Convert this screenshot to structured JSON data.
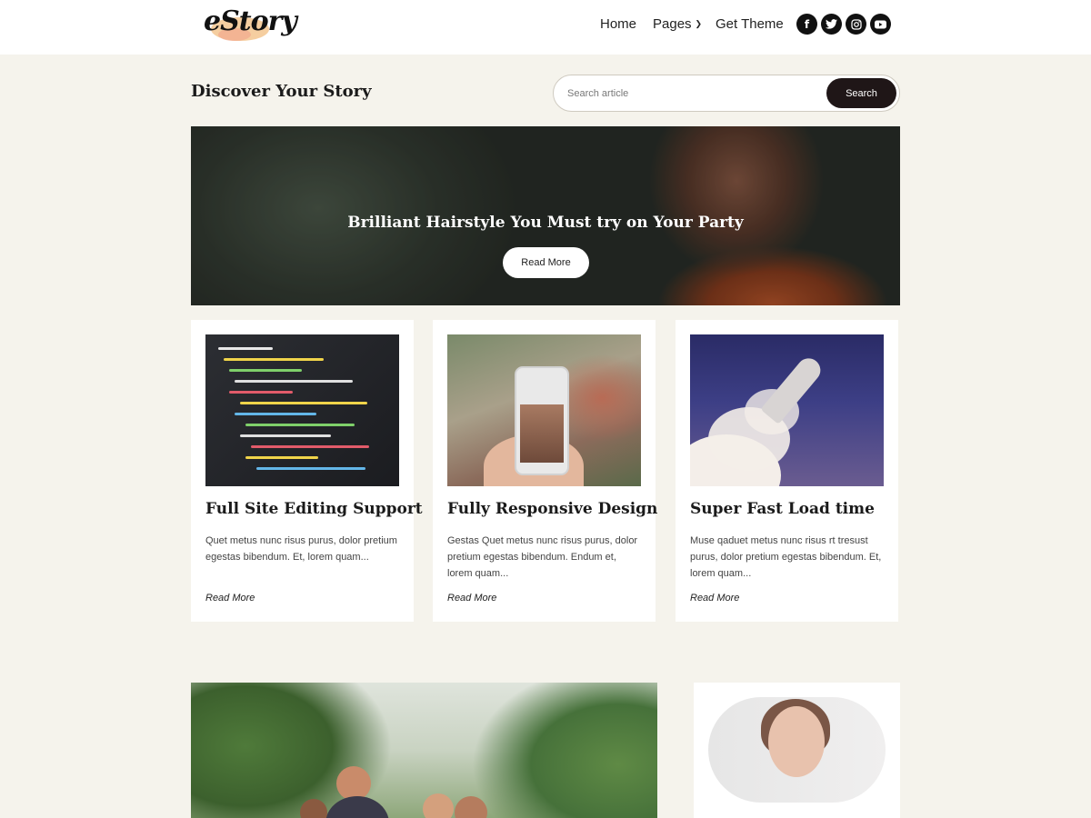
{
  "header": {
    "logo_text": "eStory",
    "nav": [
      {
        "label": "Home"
      },
      {
        "label": "Pages"
      },
      {
        "label": "Get Theme"
      }
    ],
    "social_icons": [
      "facebook-icon",
      "twitter-icon",
      "instagram-icon",
      "youtube-icon"
    ]
  },
  "search_bar": {
    "heading": "Discover Your Story",
    "placeholder": "Search article",
    "button_label": "Search"
  },
  "hero": {
    "title": "Brilliant Hairstyle You Must try on Your Party",
    "button_label": "Read More"
  },
  "cards": [
    {
      "title": "Full Site Editing Support",
      "excerpt": "Quet metus nunc risus purus, dolor pretium egestas bibendum. Et, lorem quam...",
      "link": "Read More"
    },
    {
      "title": "Fully Responsive Design",
      "excerpt": "Gestas Quet metus nunc risus purus, dolor pretium egestas bibendum. Endum et, lorem quam...",
      "link": "Read More"
    },
    {
      "title": "Super Fast Load time",
      "excerpt": "Muse qaduet metus nunc risus rt tresust purus, dolor pretium egestas bibendum. Et, lorem quam...",
      "link": "Read More"
    }
  ],
  "colors": {
    "page_background": "#f5f3ec",
    "button_dark": "#1f1617",
    "card_background": "#ffffff"
  }
}
